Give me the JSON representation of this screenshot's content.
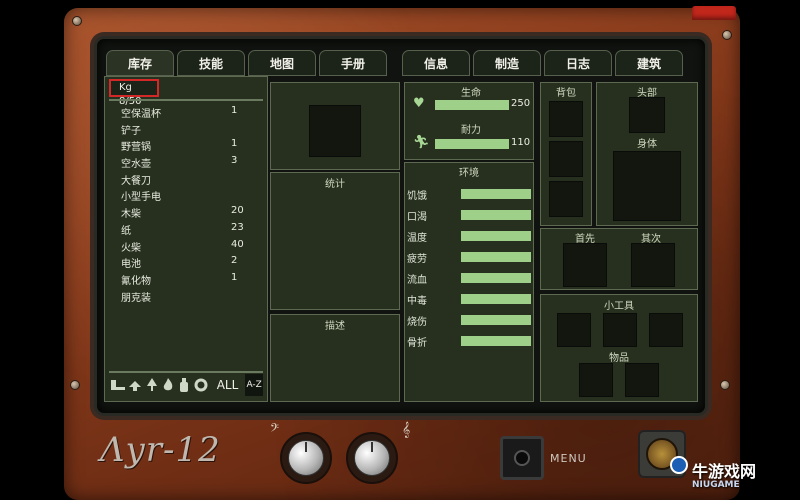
{
  "tabs": {
    "left": [
      {
        "label": "库存",
        "active": true
      },
      {
        "label": "技能",
        "active": false
      },
      {
        "label": "地图",
        "active": false
      },
      {
        "label": "手册",
        "active": false
      }
    ],
    "right": [
      {
        "label": "信息",
        "active": false
      },
      {
        "label": "制造",
        "active": false
      },
      {
        "label": "日志",
        "active": false
      },
      {
        "label": "建筑",
        "active": false
      }
    ]
  },
  "inventory": {
    "weight": "Kg 8/50",
    "items": [
      {
        "name": "空保温杯",
        "count": "1"
      },
      {
        "name": "铲子",
        "count": ""
      },
      {
        "name": "野营锅",
        "count": "1"
      },
      {
        "name": "空水壶",
        "count": "3"
      },
      {
        "name": "大餐刀",
        "count": ""
      },
      {
        "name": "小型手电",
        "count": ""
      },
      {
        "name": "木柴",
        "count": "20"
      },
      {
        "name": "纸",
        "count": "23"
      },
      {
        "name": "火柴",
        "count": "40"
      },
      {
        "name": "电池",
        "count": "2"
      },
      {
        "name": "氰化物",
        "count": "1"
      },
      {
        "name": "朋克装",
        "count": ""
      }
    ],
    "filters": {
      "icons": [
        "tools-filter-icon",
        "food-filter-icon",
        "tree-filter-icon",
        "fire-filter-icon",
        "bottle-filter-icon",
        "gear-filter-icon"
      ],
      "all_label": "ALL",
      "sort_label": "A-Z"
    }
  },
  "middle": {
    "stats_label": "统计",
    "desc_label": "描述"
  },
  "vitals": {
    "health": {
      "label": "生命",
      "value": "250",
      "level": 1.0
    },
    "stamina": {
      "label": "耐力",
      "value": "110",
      "level": 1.0
    }
  },
  "environment": {
    "label": "环境",
    "rows": [
      {
        "name": "饥饿",
        "level": 1.0
      },
      {
        "name": "口渴",
        "level": 1.0
      },
      {
        "name": "温度",
        "level": 1.0
      },
      {
        "name": "疲劳",
        "level": 1.0
      },
      {
        "name": "流血",
        "level": 1.0
      },
      {
        "name": "中毒",
        "level": 1.0
      },
      {
        "name": "烧伤",
        "level": 1.0
      },
      {
        "name": "骨折",
        "level": 1.0
      }
    ]
  },
  "equipment": {
    "backpack_label": "背包",
    "head_label": "头部",
    "body_label": "身体",
    "primary_label": "首先",
    "secondary_label": "其次",
    "tools_label": "小工具",
    "items_label": "物品"
  },
  "device": {
    "logo": "Λyr-12",
    "menu_label": "MENU",
    "bass_clef": "𝄢",
    "treble_clef": "𝄞"
  },
  "watermark": {
    "text": "牛游戏网",
    "sub": "NIUGAME"
  },
  "colors": {
    "bar_green": "#9fd08a",
    "frame_rust": "#8a3c1c",
    "panel_bg": "#27301f",
    "highlight_red": "#d32828"
  }
}
